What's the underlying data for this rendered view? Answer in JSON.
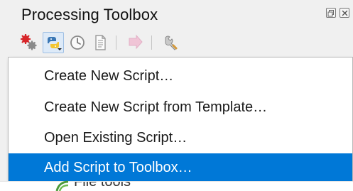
{
  "panel": {
    "title": "Processing Toolbox"
  },
  "toolbar": {
    "buttons": [
      {
        "icon": "models-icon"
      },
      {
        "icon": "python-scripts-icon",
        "active": true
      },
      {
        "icon": "history-icon"
      },
      {
        "icon": "results-viewer-icon"
      },
      {
        "icon": "edit-features-in-place-icon"
      },
      {
        "icon": "options-wrench-icon"
      }
    ]
  },
  "menu": {
    "items": [
      {
        "label": "Create New Script…"
      },
      {
        "label": "Create New Script from Template…"
      },
      {
        "label": "Open Existing Script…"
      },
      {
        "label": "Add Script to Toolbox…",
        "highlighted": true
      }
    ]
  },
  "underlying_tree": {
    "row_label": "File tools"
  },
  "colors": {
    "highlight": "#0078d7",
    "background": "#f0f0f0",
    "menu_background": "#ffffff"
  }
}
